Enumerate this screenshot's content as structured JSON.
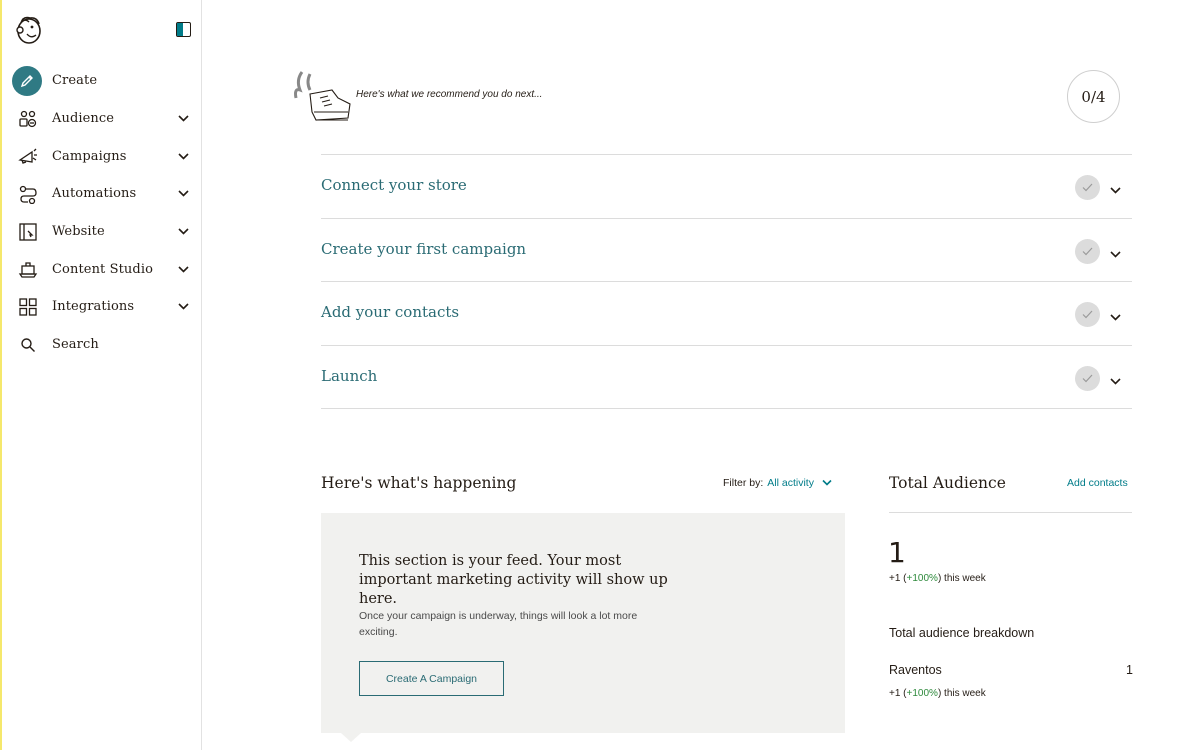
{
  "sidebar": {
    "items": [
      {
        "label": "Create",
        "icon": "pencil-icon",
        "active": true
      },
      {
        "label": "Audience",
        "icon": "audience-icon"
      },
      {
        "label": "Campaigns",
        "icon": "megaphone-icon"
      },
      {
        "label": "Automations",
        "icon": "automation-icon"
      },
      {
        "label": "Website",
        "icon": "website-icon"
      },
      {
        "label": "Content Studio",
        "icon": "content-studio-icon"
      },
      {
        "label": "Integrations",
        "icon": "grid-icon"
      },
      {
        "label": "Search",
        "icon": "search-icon"
      }
    ]
  },
  "recommend": {
    "text": "Here's what we recommend you do next...",
    "progress": "0/4"
  },
  "steps": [
    {
      "label": "Connect your store"
    },
    {
      "label": "Create your first campaign"
    },
    {
      "label": "Add your contacts"
    },
    {
      "label": "Launch"
    }
  ],
  "feed": {
    "title": "Here's what's happening",
    "filter_label": "Filter by:",
    "filter_value": "All activity",
    "heading": "This section is your feed. Your most important marketing activity will show up here.",
    "sub": "Once your campaign is underway, things will look a lot more exciting.",
    "button": "Create A Campaign"
  },
  "audience": {
    "title": "Total Audience",
    "add_link": "Add contacts",
    "count": "1",
    "change_prefix": "+1 (",
    "change_pct": "+100%",
    "change_suffix": ") this week",
    "breakdown_title": "Total audience breakdown",
    "breakdown": {
      "name": "Raventos",
      "count": "1",
      "change_prefix": "+1 (",
      "change_pct": "+100%",
      "change_suffix": ") this week"
    }
  },
  "colors": {
    "accent": "#007c89",
    "step_text": "#2a6b74",
    "positive": "#2e8a3c",
    "feed_bg": "#f1f1ef"
  }
}
